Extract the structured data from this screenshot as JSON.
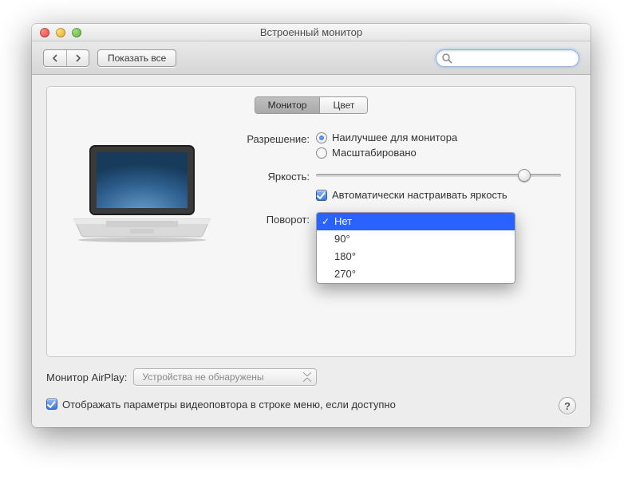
{
  "window": {
    "title": "Встроенный монитор"
  },
  "toolbar": {
    "show_all": "Показать все",
    "search_placeholder": ""
  },
  "tabs": {
    "monitor": "Монитор",
    "color": "Цвет",
    "active": "monitor"
  },
  "resolution": {
    "label": "Разрешение:",
    "best": "Наилучшее для монитора",
    "scaled": "Масштабировано",
    "selected": "best"
  },
  "brightness": {
    "label": "Яркость:",
    "auto_label": "Автоматически настраивать яркость",
    "auto_checked": true,
    "value_percent": 85
  },
  "rotation": {
    "label": "Поворот:",
    "options": [
      "Нет",
      "90°",
      "180°",
      "270°"
    ],
    "selected_index": 0
  },
  "airplay": {
    "label": "Монитор AirPlay:",
    "value": "Устройства не обнаружены"
  },
  "mirroring": {
    "label": "Отображать параметры видеоповтора в строке меню, если доступно",
    "checked": true
  },
  "help_symbol": "?"
}
